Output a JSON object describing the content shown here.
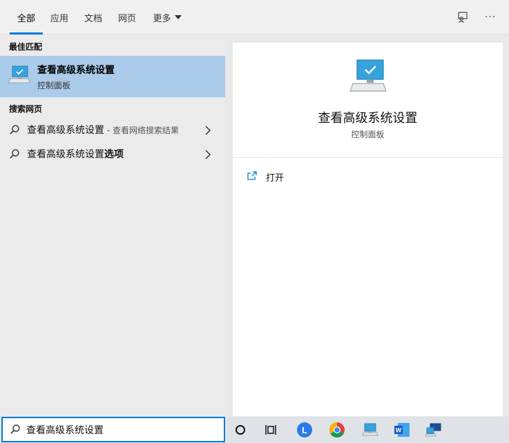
{
  "tabs": [
    {
      "label": "全部",
      "active": true
    },
    {
      "label": "应用",
      "active": false
    },
    {
      "label": "文档",
      "active": false
    },
    {
      "label": "网页",
      "active": false
    },
    {
      "label": "更多",
      "active": false
    }
  ],
  "top_icons": [
    "feedback-icon",
    "more-options-icon"
  ],
  "more_options_label": "···",
  "left": {
    "best_match_heading": "最佳匹配",
    "best_match": {
      "title": "查看高级系统设置",
      "subtitle": "控制面板",
      "icon": "computer-monitor-icon"
    },
    "web_heading": "搜索网页",
    "web_results": [
      {
        "text": "查看高级系统设置",
        "bold_suffix": "",
        "hint": " - 查看网络搜索结果"
      },
      {
        "text": "查看高级系统设置",
        "bold_suffix": "选项",
        "hint": ""
      }
    ]
  },
  "right": {
    "title": "查看高级系统设置",
    "subtitle": "控制面板",
    "actions": [
      {
        "label": "打开",
        "icon": "open-icon"
      }
    ]
  },
  "search": {
    "value": "查看高级系统设置"
  },
  "taskbar": {
    "icons": [
      "cortana-icon",
      "task-view-icon",
      "blue-l-app-icon",
      "chrome-icon",
      "computer-app-icon",
      "word-icon",
      "network-computer-icon"
    ],
    "word_letter": "W",
    "l_letter": "L"
  },
  "colors": {
    "accent": "#0078d7",
    "selected_bg": "#aacbe9"
  }
}
